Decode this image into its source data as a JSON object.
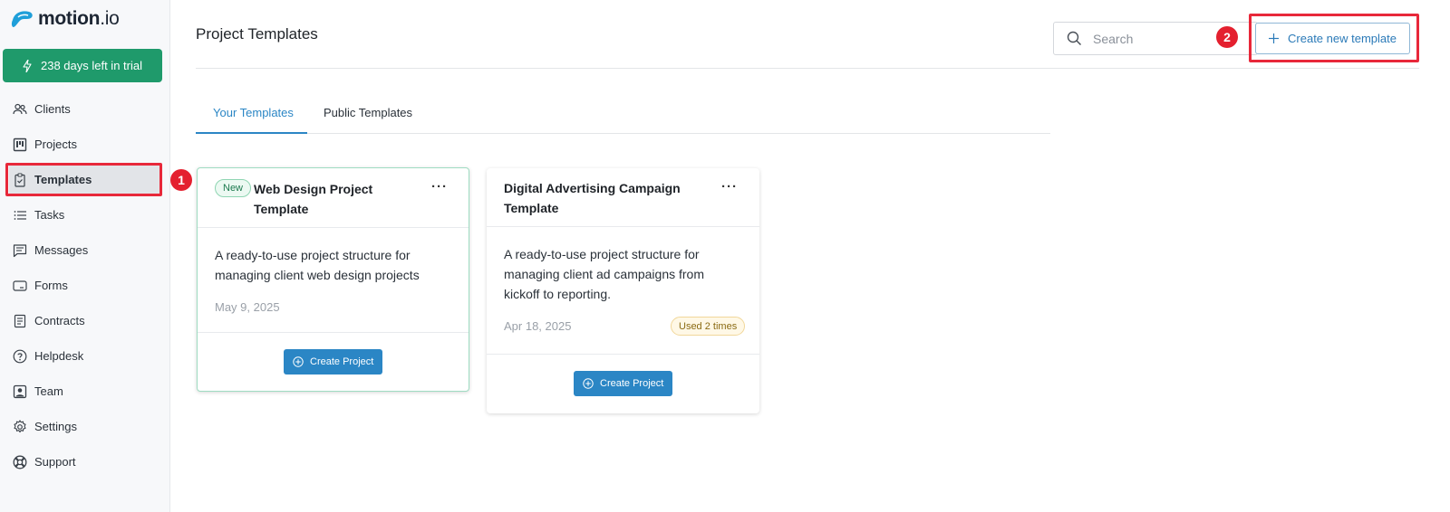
{
  "sidebar": {
    "logo": {
      "name": "motion",
      "tld": ".io"
    },
    "trial_label": "238 days left in trial",
    "items": [
      {
        "label": "Clients",
        "icon": "users-icon"
      },
      {
        "label": "Projects",
        "icon": "kanban-icon"
      },
      {
        "label": "Templates",
        "icon": "clipboard-check-icon",
        "active": true
      },
      {
        "label": "Tasks",
        "icon": "list-icon"
      },
      {
        "label": "Messages",
        "icon": "message-icon"
      },
      {
        "label": "Forms",
        "icon": "form-icon"
      },
      {
        "label": "Contracts",
        "icon": "document-icon"
      },
      {
        "label": "Helpdesk",
        "icon": "help-circle-icon"
      },
      {
        "label": "Team",
        "icon": "person-badge-icon"
      },
      {
        "label": "Settings",
        "icon": "gear-icon"
      },
      {
        "label": "Support",
        "icon": "lifebuoy-icon"
      }
    ]
  },
  "header": {
    "title": "Project Templates",
    "search_placeholder": "Search",
    "create_template_label": "Create new template"
  },
  "tabs": [
    {
      "label": "Your Templates",
      "active": true
    },
    {
      "label": "Public Templates",
      "active": false
    }
  ],
  "annotations": {
    "step1": "1",
    "step2": "2"
  },
  "templates": [
    {
      "badge": "New",
      "title_line1": "Web Design Project",
      "title_line2": "Template",
      "desc_line1": "A ready-to-use project structure for",
      "desc_line2": "managing client web design projects",
      "date": "May 9, 2025",
      "action_label": "Create Project"
    },
    {
      "title_line1": "Digital Advertising Campaign",
      "title_line2": "Template",
      "desc_line1": "A ready-to-use project structure for",
      "desc_line2": "managing client ad campaigns from",
      "desc_line3": "kickoff to reporting.",
      "date": "Apr 18, 2025",
      "usage": "Used 2 times",
      "action_label": "Create Project"
    }
  ],
  "colors": {
    "accent_blue": "#2b86c5",
    "trial_green": "#1f9a6b",
    "annotation_red": "#e8283a"
  }
}
